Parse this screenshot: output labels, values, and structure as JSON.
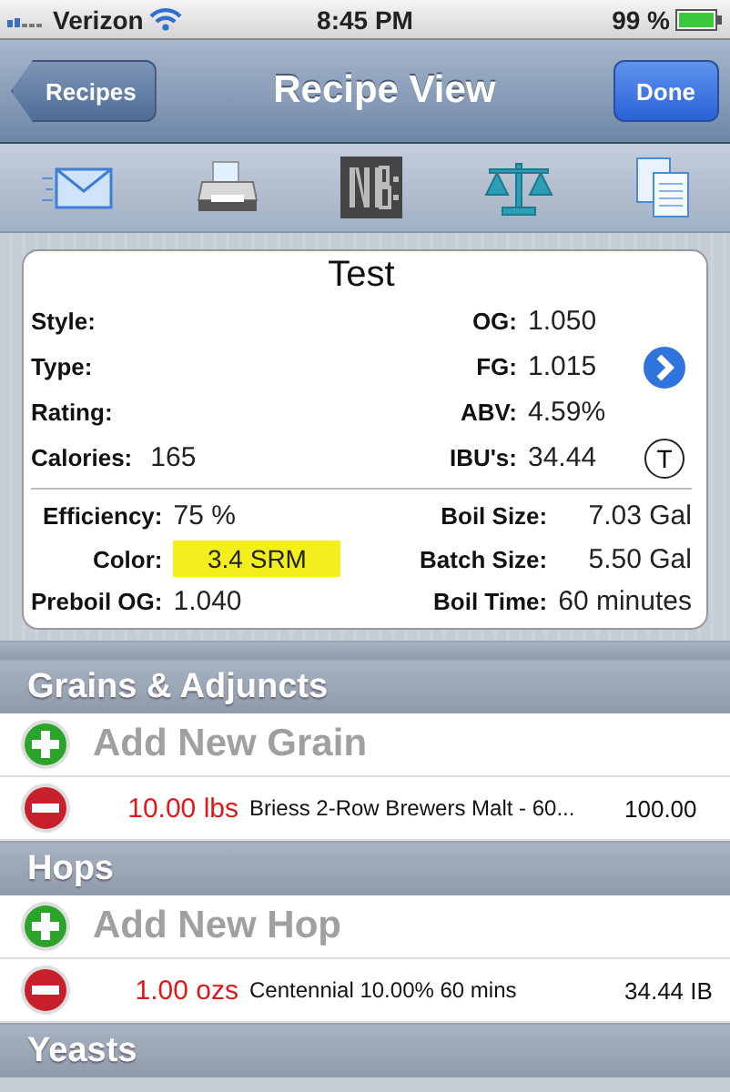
{
  "status_bar": {
    "carrier": "Verizon",
    "time": "8:45 PM",
    "battery": "99 %"
  },
  "nav_bar": {
    "back": "Recipes",
    "title": "Recipe View",
    "done": "Done"
  },
  "summary": {
    "title": "Test",
    "left_fields": [
      {
        "label": "Style:"
      },
      {
        "label": "Type:"
      },
      {
        "label": "Rating:"
      },
      {
        "label": "Calories:",
        "value": "165"
      }
    ],
    "right_fields": [
      {
        "kind": "plain",
        "label": "OG:",
        "value": "1.050"
      },
      {
        "kind": "disclosure",
        "label": "FG:",
        "value": "1.015"
      },
      {
        "kind": "plain",
        "label": "ABV:",
        "value": "4.59%"
      },
      {
        "kind": "toggle",
        "label": "IBU's:",
        "value": "34.44",
        "toggle_label": "T"
      }
    ],
    "details": [
      {
        "label": "Efficiency:",
        "value": "75 %",
        "label_2": "Boil Size:",
        "value_2": "7.03 Gal"
      },
      {
        "label": "Color:",
        "value": "3.4 SRM",
        "color": "#f3ef1c",
        "label_2": "Batch Size:",
        "value_2": "5.50 Gal"
      },
      {
        "label": "Preboil OG:",
        "value": "1.040",
        "label_2": "Boil Time:",
        "value_2": "60 minutes"
      }
    ]
  },
  "sections": [
    {
      "title": "Grains & Adjuncts",
      "rows": [
        {
          "kind": "add",
          "label": "Add New Grain"
        },
        {
          "kind": "item",
          "amount": "10.00 lbs",
          "name": "Briess 2-Row Brewers Malt - 60...",
          "value": "100.00"
        }
      ]
    },
    {
      "title": "Hops",
      "rows": [
        {
          "kind": "add",
          "label": "Add New Hop"
        },
        {
          "kind": "item",
          "amount": "1.00 ozs",
          "name": "Centennial 10.00% 60 mins",
          "value": "34.44 IB"
        }
      ]
    },
    {
      "title": "Yeasts"
    }
  ]
}
